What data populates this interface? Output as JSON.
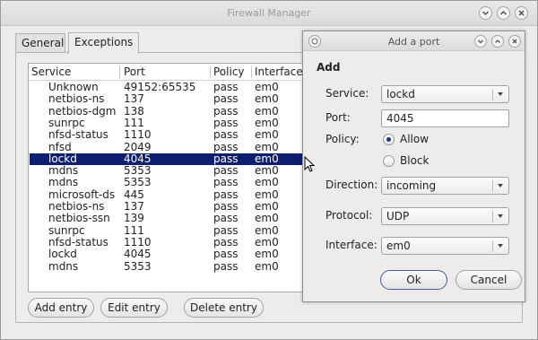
{
  "window": {
    "title": "Firewall Manager",
    "tabs": [
      {
        "label": "General"
      },
      {
        "label": "Exceptions"
      }
    ]
  },
  "list": {
    "headers": [
      "Service",
      "Port",
      "Policy",
      "Interface"
    ],
    "rows": [
      {
        "service": "Unknown",
        "port": "49152:65535",
        "policy": "pass",
        "iface": "em0"
      },
      {
        "service": "netbios-ns",
        "port": "137",
        "policy": "pass",
        "iface": "em0"
      },
      {
        "service": "netbios-dgm",
        "port": "138",
        "policy": "pass",
        "iface": "em0"
      },
      {
        "service": "sunrpc",
        "port": "111",
        "policy": "pass",
        "iface": "em0"
      },
      {
        "service": "nfsd-status",
        "port": "1110",
        "policy": "pass",
        "iface": "em0"
      },
      {
        "service": "nfsd",
        "port": "2049",
        "policy": "pass",
        "iface": "em0"
      },
      {
        "service": "lockd",
        "port": "4045",
        "policy": "pass",
        "iface": "em0"
      },
      {
        "service": "mdns",
        "port": "5353",
        "policy": "pass",
        "iface": "em0"
      },
      {
        "service": "mdns",
        "port": "5353",
        "policy": "pass",
        "iface": "em0"
      },
      {
        "service": "microsoft-ds",
        "port": "445",
        "policy": "pass",
        "iface": "em0"
      },
      {
        "service": "netbios-ns",
        "port": "137",
        "policy": "pass",
        "iface": "em0"
      },
      {
        "service": "netbios-ssn",
        "port": "139",
        "policy": "pass",
        "iface": "em0"
      },
      {
        "service": "sunrpc",
        "port": "111",
        "policy": "pass",
        "iface": "em0"
      },
      {
        "service": "nfsd-status",
        "port": "1110",
        "policy": "pass",
        "iface": "em0"
      },
      {
        "service": "lockd",
        "port": "4045",
        "policy": "pass",
        "iface": "em0"
      },
      {
        "service": "mdns",
        "port": "5353",
        "policy": "pass",
        "iface": "em0"
      }
    ],
    "selected_index": 6
  },
  "buttons": {
    "add": "Add entry",
    "edit": "Edit entry",
    "delete": "Delete entry"
  },
  "dialog": {
    "title": "Add a port",
    "heading": "Add",
    "service_label": "Service:",
    "service_value": "lockd",
    "port_label": "Port:",
    "port_value": "4045",
    "policy_label": "Policy:",
    "policy_allow": "Allow",
    "policy_block": "Block",
    "policy_selected": "Allow",
    "direction_label": "Direction:",
    "direction_value": "incoming",
    "protocol_label": "Protocol:",
    "protocol_value": "UDP",
    "interface_label": "Interface:",
    "interface_value": "em0",
    "ok_label": "Ok",
    "cancel_label": "Cancel"
  },
  "colors": {
    "selection": "#0f1f6f",
    "desktop": "#6b98c8"
  }
}
